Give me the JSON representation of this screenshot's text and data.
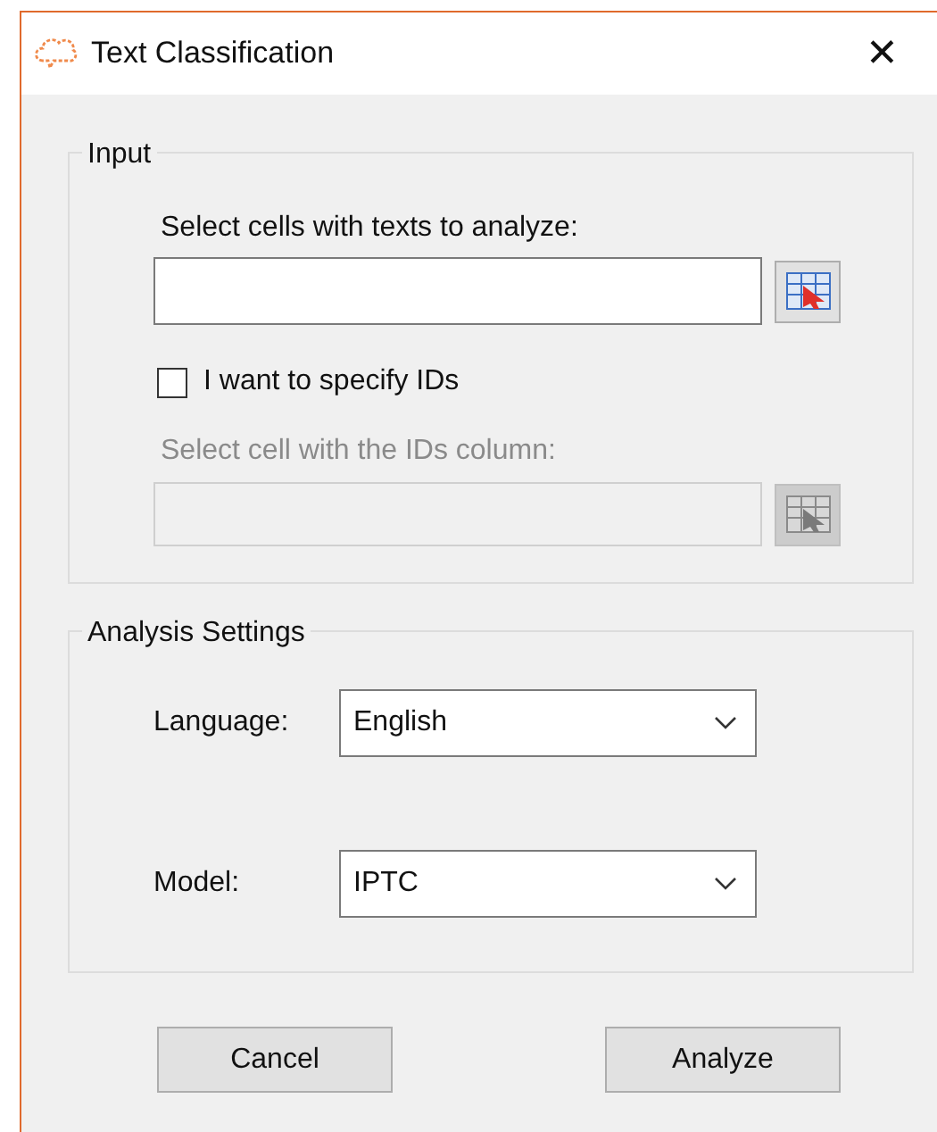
{
  "window": {
    "title": "Text Classification",
    "close": "✕"
  },
  "input_group": {
    "title": "Input",
    "texts_label": "Select cells with texts to analyze:",
    "texts_field": {
      "disabled": false
    },
    "specify_ids": {
      "label": "I want to specify IDs",
      "checked": false
    },
    "ids_label": "Select cell with the IDs column:",
    "ids_field": {
      "disabled": true
    }
  },
  "analysis_settings": {
    "title": "Analysis Settings",
    "rows": [
      {
        "label": "Language:",
        "value": "English"
      },
      {
        "label": "Model:",
        "value": "IPTC"
      }
    ]
  },
  "buttons": [
    {
      "label": "Cancel"
    },
    {
      "label": "Analyze"
    }
  ]
}
